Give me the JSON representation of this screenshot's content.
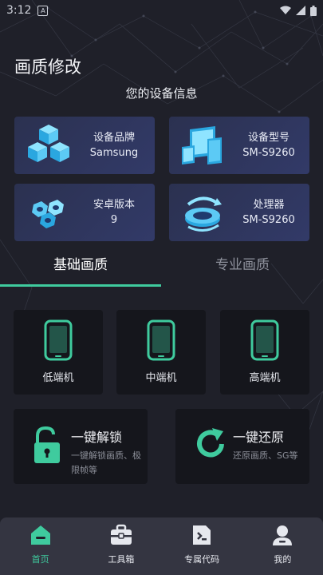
{
  "status_bar": {
    "time": "3:12",
    "badge": "A"
  },
  "page": {
    "title": "画质修改",
    "section_title": "您的设备信息"
  },
  "device_info": [
    {
      "label": "设备品牌",
      "value": "Samsung",
      "icon": "cubes-icon"
    },
    {
      "label": "设备型号",
      "value": "SM-S9260",
      "icon": "devices-icon"
    },
    {
      "label": "安卓版本",
      "value": "9",
      "icon": "nuts-icon"
    },
    {
      "label": "处理器",
      "value": "SM-S9260",
      "icon": "processor-icon"
    }
  ],
  "tabs": [
    {
      "label": "基础画质",
      "active": true
    },
    {
      "label": "专业画质",
      "active": false
    }
  ],
  "presets": [
    {
      "label": "低端机"
    },
    {
      "label": "中端机"
    },
    {
      "label": "高端机"
    }
  ],
  "actions": [
    {
      "title": "一键解锁",
      "desc": "一键解锁画质、极限帧等",
      "icon": "unlock-icon"
    },
    {
      "title": "一键还原",
      "desc": "还原画质、SG等",
      "icon": "restore-icon"
    }
  ],
  "bottom_nav": [
    {
      "label": "首页",
      "icon": "home-icon",
      "active": true
    },
    {
      "label": "工具箱",
      "icon": "toolbox-icon",
      "active": false
    },
    {
      "label": "专属代码",
      "icon": "code-file-icon",
      "active": false
    },
    {
      "label": "我的",
      "icon": "profile-icon",
      "active": false
    }
  ],
  "colors": {
    "accent": "#3fcb9e",
    "background": "#1f2029",
    "card": "#15161c",
    "info_card": "#2f3560",
    "nav": "#343541"
  }
}
